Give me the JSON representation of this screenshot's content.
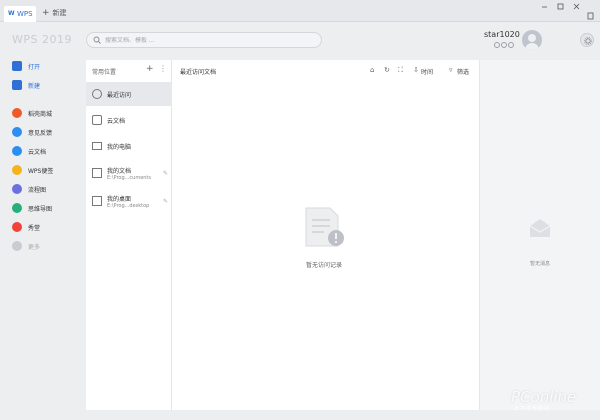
{
  "titlebar": {
    "active_tab": "WPS",
    "new_tab": "新建"
  },
  "header": {
    "brand": "WPS 2019",
    "search_placeholder": "搜索文档、模板 ...",
    "user_name": "star1020"
  },
  "nav": {
    "open": "打开",
    "new": "新建",
    "items": [
      {
        "label": "稻壳商城",
        "color": "#f05a28"
      },
      {
        "label": "意见反馈",
        "color": "#2b8ef0"
      },
      {
        "label": "云文档",
        "color": "#2b8ef0"
      },
      {
        "label": "WPS便签",
        "color": "#f5b21b"
      },
      {
        "label": "流程图",
        "color": "#6b6fe0"
      },
      {
        "label": "思维导图",
        "color": "#27b07a"
      },
      {
        "label": "秀堂",
        "color": "#f0433a"
      },
      {
        "label": "更多",
        "color": "#c9ccd1"
      }
    ]
  },
  "places": {
    "header": "常用位置",
    "items": [
      {
        "label": "最近访问"
      },
      {
        "label": "云文档"
      },
      {
        "label": "我的电脑"
      },
      {
        "label": "我的文档",
        "path": "E:\\Prog...cuments"
      },
      {
        "label": "我的桌面",
        "path": "E:\\Prog...desktop"
      }
    ]
  },
  "recent": {
    "title": "最近访问文档",
    "sort_label": "时间",
    "filter_label": "筛选",
    "empty_text": "暂无访问记录"
  },
  "right": {
    "empty_text": "暂无消息"
  },
  "watermark": {
    "text": "PConline",
    "sub": "太平洋电脑网"
  }
}
